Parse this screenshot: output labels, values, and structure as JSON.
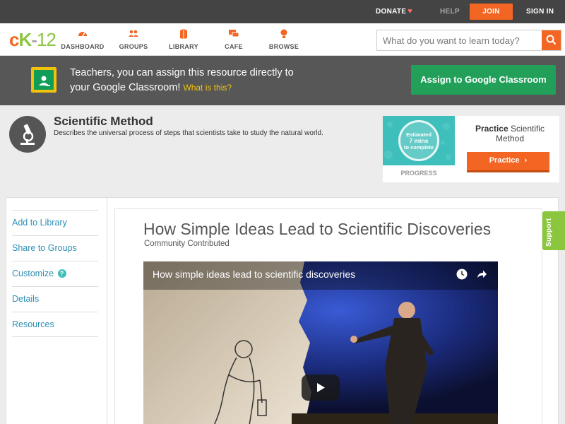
{
  "topbar": {
    "donate": "DONATE",
    "help": "HELP",
    "join": "JOIN",
    "sign_in": "SIGN IN"
  },
  "nav": {
    "logo": {
      "c": "c",
      "k": "K",
      "dash": "-",
      "num": "12"
    },
    "items": [
      {
        "label": "DASHBOARD",
        "icon": "dashboard-icon"
      },
      {
        "label": "GROUPS",
        "icon": "groups-icon"
      },
      {
        "label": "LIBRARY",
        "icon": "library-icon"
      },
      {
        "label": "CAFE",
        "icon": "cafe-icon"
      },
      {
        "label": "BROWSE",
        "icon": "browse-icon"
      }
    ],
    "search_placeholder": "What do you want to learn today?"
  },
  "banner": {
    "line1": "Teachers, you can assign this resource directly to",
    "line2": "your Google Classroom!",
    "what_link": "What is this?",
    "assign_button": "Assign to Google Classroom"
  },
  "concept": {
    "title": "Scientific Method",
    "description": "Describes the universal process of steps that scientists take to study the natural world.",
    "progress": {
      "estimated": "Estimated",
      "mins": "7 mins",
      "complete": "to complete",
      "label": "PROGRESS"
    },
    "practice": {
      "prefix": "Practice",
      "topic": "Scientific Method",
      "button": "Practice"
    }
  },
  "sidebar": {
    "items": [
      {
        "label": "Add to Library"
      },
      {
        "label": "Share to Groups"
      },
      {
        "label": "Customize",
        "help": "?"
      },
      {
        "label": "Details"
      },
      {
        "label": "Resources"
      }
    ]
  },
  "article": {
    "title": "How Simple Ideas Lead to Scientific Discoveries",
    "meta": "Community Contributed",
    "video_title": "How simple ideas lead to scientific discoveries"
  },
  "support_tab": "Support",
  "colors": {
    "brand_orange": "#f26522",
    "brand_green": "#8cc63f",
    "link_blue": "#2f8fb5",
    "classroom_green": "#22a05a"
  }
}
